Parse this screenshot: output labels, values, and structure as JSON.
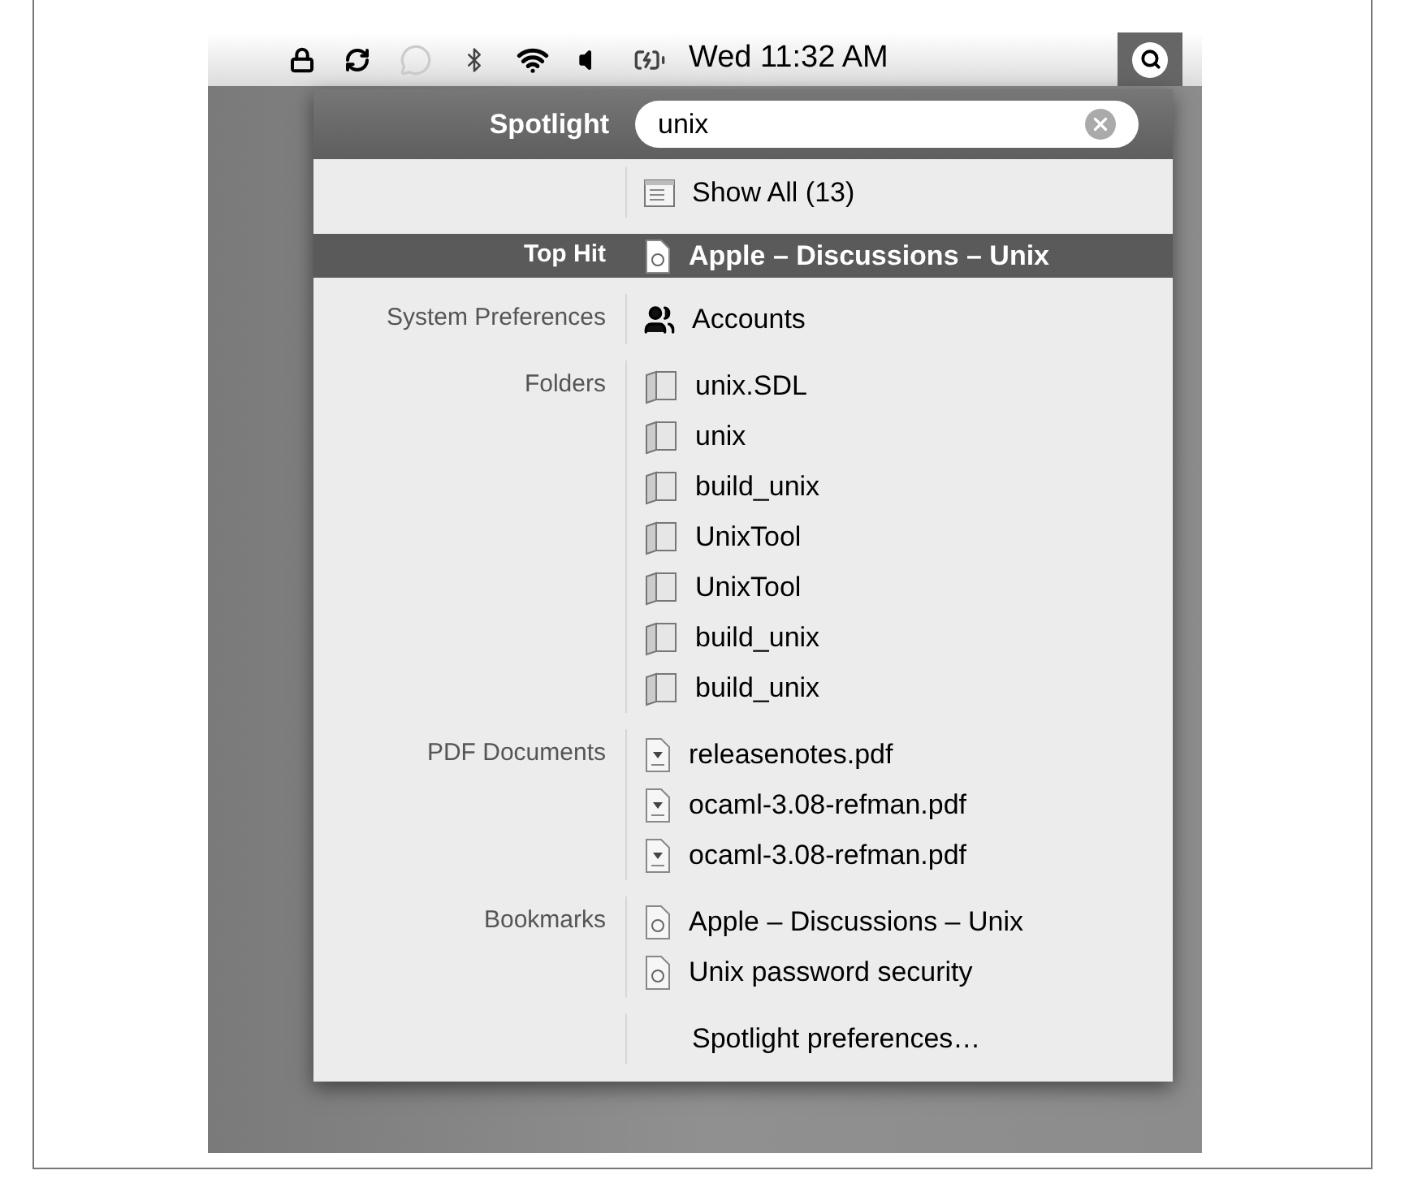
{
  "menu_bar": {
    "clock": "Wed 11:32 AM"
  },
  "spotlight": {
    "title": "Spotlight",
    "query": "unix"
  },
  "groups": [
    {
      "items": [
        {
          "kind": "list",
          "label": "Show All (13)",
          "selected": false
        }
      ]
    },
    {
      "category": "Top Hit",
      "items": [
        {
          "kind": "web",
          "label": "Apple – Discussions – Unix",
          "selected": true
        }
      ]
    },
    {
      "category": "System Preferences",
      "items": [
        {
          "kind": "accounts",
          "label": "Accounts",
          "selected": false
        }
      ]
    },
    {
      "category": "Folders",
      "items": [
        {
          "kind": "folder",
          "label": "unix.SDL",
          "selected": false
        },
        {
          "kind": "folder",
          "label": "unix",
          "selected": false
        },
        {
          "kind": "folder",
          "label": "build_unix",
          "selected": false
        },
        {
          "kind": "folder",
          "label": "UnixTool",
          "selected": false
        },
        {
          "kind": "folder",
          "label": "UnixTool",
          "selected": false
        },
        {
          "kind": "folder",
          "label": "build_unix",
          "selected": false
        },
        {
          "kind": "folder",
          "label": "build_unix",
          "selected": false
        }
      ]
    },
    {
      "category": "PDF Documents",
      "items": [
        {
          "kind": "pdf",
          "label": "releasenotes.pdf",
          "selected": false
        },
        {
          "kind": "pdf",
          "label": "ocaml-3.08-refman.pdf",
          "selected": false
        },
        {
          "kind": "pdf",
          "label": "ocaml-3.08-refman.pdf",
          "selected": false
        }
      ]
    },
    {
      "category": "Bookmarks",
      "items": [
        {
          "kind": "web",
          "label": "Apple – Discussions – Unix",
          "selected": false
        },
        {
          "kind": "web",
          "label": "Unix password security",
          "selected": false
        }
      ]
    },
    {
      "items": [
        {
          "kind": "none",
          "label": "Spotlight preferences…",
          "selected": false
        }
      ]
    }
  ]
}
